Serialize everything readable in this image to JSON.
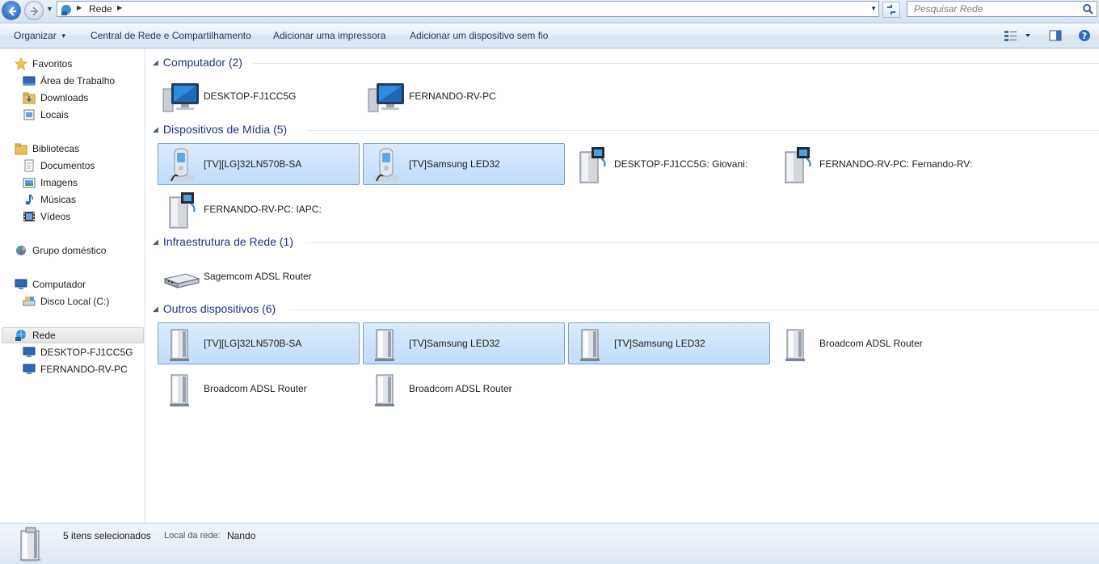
{
  "address_bar": {
    "breadcrumb": "Rede",
    "search_placeholder": "Pesquisar Rede",
    "back_icon": "back-arrow-icon",
    "forward_icon": "forward-arrow-icon",
    "refresh_icon": "refresh-icon"
  },
  "toolbar": {
    "organize": "Organizar",
    "network_center": "Central de Rede e Compartilhamento",
    "add_printer": "Adicionar uma impressora",
    "add_wireless": "Adicionar um dispositivo sem fio"
  },
  "nav": {
    "favorites": "Favoritos",
    "desktop": "Área de Trabalho",
    "downloads": "Downloads",
    "places": "Locais",
    "libraries": "Bibliotecas",
    "documents": "Documentos",
    "images": "Imagens",
    "music": "Músicas",
    "videos": "Vídeos",
    "homegroup": "Grupo doméstico",
    "computer": "Computador",
    "local_disk": "Disco Local (C:)",
    "network": "Rede",
    "pc1": "DESKTOP-FJ1CC5G",
    "pc2": "FERNANDO-RV-PC"
  },
  "groups": {
    "computers": {
      "title": "Computador (2)",
      "items": [
        {
          "label": "DESKTOP-FJ1CC5G",
          "selected": false
        },
        {
          "label": "FERNANDO-RV-PC",
          "selected": false
        }
      ]
    },
    "media": {
      "title": "Dispositivos de Mídia (5)",
      "items": [
        {
          "label": "[TV][LG]32LN570B-SA",
          "selected": true
        },
        {
          "label": "[TV]Samsung LED32",
          "selected": true
        },
        {
          "label": "DESKTOP-FJ1CC5G: Giovani:",
          "selected": false
        },
        {
          "label": "FERNANDO-RV-PC: Fernando-RV:",
          "selected": false
        },
        {
          "label": "FERNANDO-RV-PC: IAPC:",
          "selected": false
        }
      ]
    },
    "infra": {
      "title": "Infraestrutura de Rede (1)",
      "items": [
        {
          "label": "Sagemcom ADSL Router",
          "selected": false
        }
      ]
    },
    "other": {
      "title": "Outros dispositivos (6)",
      "items": [
        {
          "label": "[TV][LG]32LN570B-SA",
          "selected": true
        },
        {
          "label": "[TV]Samsung LED32",
          "selected": true
        },
        {
          "label": "[TV]Samsung LED32",
          "selected": true
        },
        {
          "label": "Broadcom ADSL Router",
          "selected": false
        },
        {
          "label": "Broadcom ADSL Router",
          "selected": false
        },
        {
          "label": "Broadcom ADSL Router",
          "selected": false
        }
      ]
    }
  },
  "status": {
    "count": "5 itens selecionados",
    "location_key": "Local da rede:",
    "location_value": "Nando"
  }
}
